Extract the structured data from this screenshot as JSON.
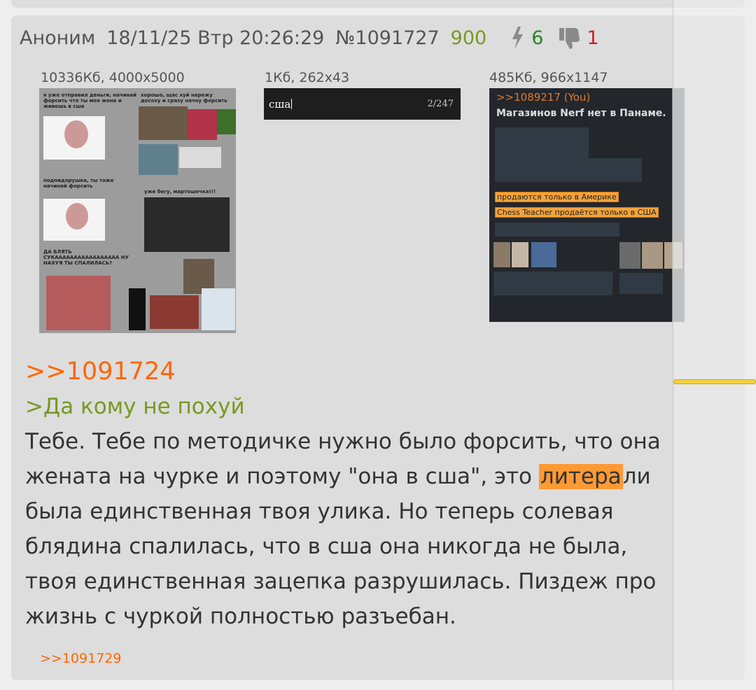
{
  "post": {
    "name": "Аноним",
    "date": "18/11/25 Втр 20:26:29",
    "number": "№1091727",
    "count": "900",
    "likes": "6",
    "dislikes": "1",
    "icons": {
      "like": "lightning-icon",
      "dislike": "thumbs-down-icon"
    }
  },
  "files": [
    {
      "info": "10336Кб, 4000x5000"
    },
    {
      "info": "1Кб, 262x43",
      "search_text": "сша",
      "search_count": "2/247"
    },
    {
      "info": "485Кб, 966x1147",
      "reply": ">>1089217 (You)",
      "title": "Магазинов Nerf нет в Панаме.",
      "hl1": "продаются только в Америке",
      "hl2": "Chess Teacher продаётся только в США"
    }
  ],
  "thumb1_captions": {
    "a": "я уже отправил деньги, начинай форсить что ты моя жена и живешь в сша",
    "b": "хорошо, щас хуй нарежу досоху и сразу начну форсить",
    "c": "подпидорушка, ты тоже начинай форсить",
    "d": "уже бегу, мартошечка!!!",
    "e": "ДА БЛЯТЬ СУКААААААААААААААААА НУ НАХУЯ ТЫ СПАЛИЛАСЬ?"
  },
  "body": {
    "reply_link": ">>1091724",
    "greentext": ">Да кому не похуй",
    "line1": "Тебе. Тебе по методичке нужно было форсить, что она",
    "line2_a": "жената на чурке и поэтому \"она в сша\", это ",
    "line2_hl": "литера",
    "line2_b": "ли",
    "line3": "была единственная твоя улика. Но теперь солевая",
    "line4": "блядина спалилась, что в сша она никогда не была,",
    "line5": "твоя единственная зацепка разрушилась. Пиздеж про",
    "line6": "жизнь с чуркой полностью разъебан."
  },
  "answers": [
    ">>1091729"
  ],
  "colors": {
    "reply": "#ff6600",
    "greentext": "#789922",
    "likes": "#228822",
    "dislikes": "#cc2222",
    "highlight": "#ff9933"
  }
}
